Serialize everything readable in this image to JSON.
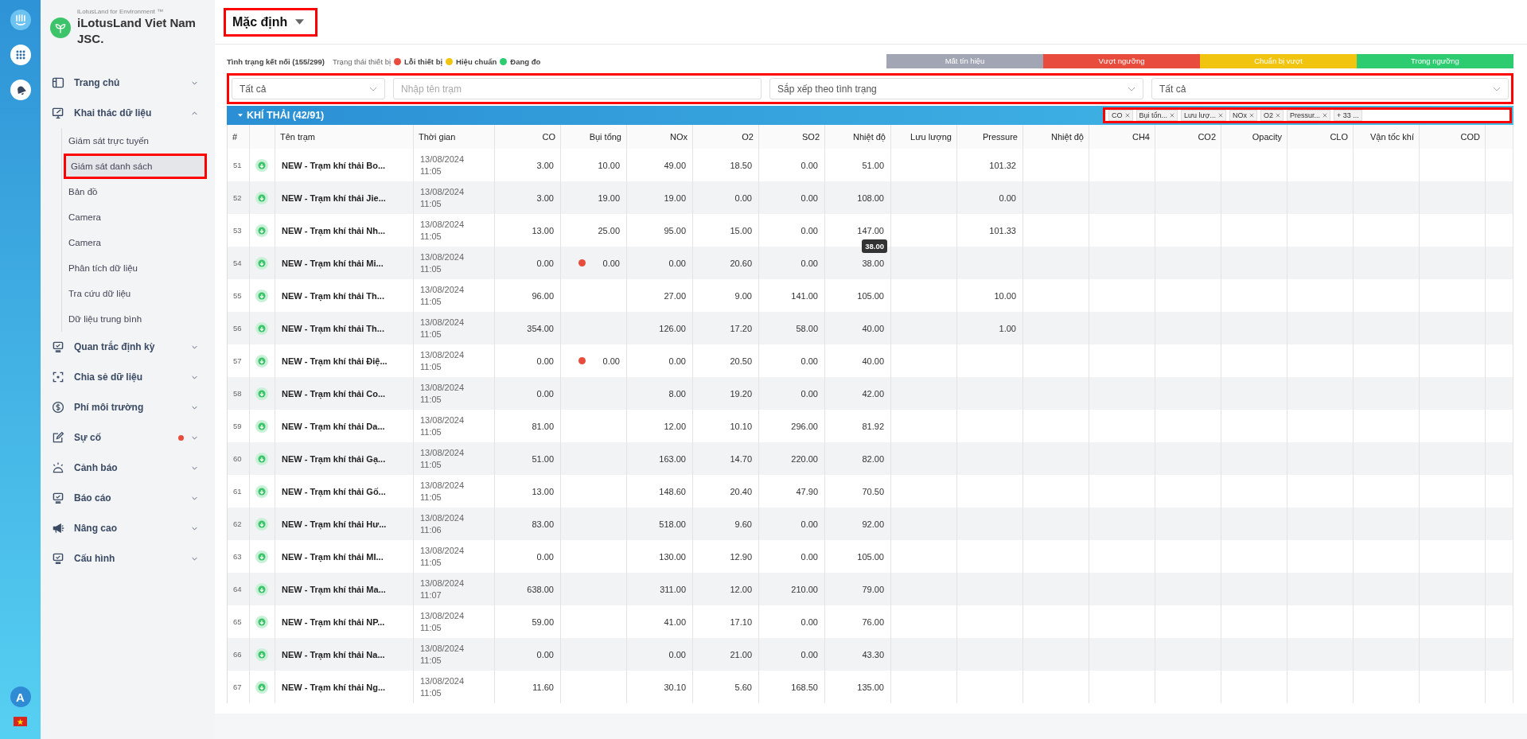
{
  "rail": {
    "user_initial": "A"
  },
  "brand": {
    "tagline": "iLotusLand for Environment ™",
    "name": "iLotusLand Viet Nam JSC."
  },
  "menu": [
    {
      "label": "Trang chủ",
      "expanded": false,
      "alert": false
    },
    {
      "label": "Khai thác dữ liệu",
      "expanded": true,
      "alert": false,
      "children": [
        {
          "label": "Giám sát trực tuyến",
          "selected": false,
          "highlighted": false
        },
        {
          "label": "Giám sát danh sách",
          "selected": true,
          "highlighted": true
        },
        {
          "label": "Bản đồ",
          "selected": false,
          "highlighted": false
        },
        {
          "label": "Camera",
          "selected": false,
          "highlighted": false
        },
        {
          "label": "Camera",
          "selected": false,
          "highlighted": false
        },
        {
          "label": "Phân tích dữ liệu",
          "selected": false,
          "highlighted": false
        },
        {
          "label": "Tra cứu dữ liệu",
          "selected": false,
          "highlighted": false
        },
        {
          "label": "Dữ liệu trung bình",
          "selected": false,
          "highlighted": false
        }
      ]
    },
    {
      "label": "Quan trắc định kỳ",
      "expanded": false,
      "alert": false
    },
    {
      "label": "Chia sẻ dữ liệu",
      "expanded": false,
      "alert": false
    },
    {
      "label": "Phí môi trường",
      "expanded": false,
      "alert": false
    },
    {
      "label": "Sự cố",
      "expanded": false,
      "alert": true
    },
    {
      "label": "Cảnh báo",
      "expanded": false,
      "alert": false
    },
    {
      "label": "Báo cáo",
      "expanded": false,
      "alert": false
    },
    {
      "label": "Nâng cao",
      "expanded": false,
      "alert": false
    },
    {
      "label": "Cấu hình",
      "expanded": false,
      "alert": false
    }
  ],
  "view_title": {
    "text": "Mặc định",
    "highlighted": true
  },
  "status": {
    "connection": "Tình trạng kết nối (155/299)",
    "device_label": "Trạng thái thiết bị",
    "device_states": [
      {
        "label": "Lỗi thiết bị",
        "color": "#e74c3c"
      },
      {
        "label": "Hiệu chuẩn",
        "color": "#f1c40f"
      },
      {
        "label": "Đang đo",
        "color": "#2ecc71"
      }
    ]
  },
  "legend": [
    {
      "label": "Mất tín hiệu",
      "color": "#a2a5b3"
    },
    {
      "label": "Vượt ngưỡng",
      "color": "#e74c3c"
    },
    {
      "label": "Chuẩn bị vượt",
      "color": "#f1c40f"
    },
    {
      "label": "Trong ngưỡng",
      "color": "#2ecc71"
    }
  ],
  "filters": {
    "highlighted": true,
    "fields": [
      {
        "kind": "select",
        "value": "Tất cả"
      },
      {
        "kind": "input",
        "placeholder": "Nhập tên trạm"
      },
      {
        "kind": "select",
        "value": "Sắp xếp theo tình trạng"
      },
      {
        "kind": "select",
        "value": "Tất cả"
      }
    ]
  },
  "section": {
    "title": "KHÍ THẢI (42/91)",
    "expanded": true,
    "tags_highlighted": true,
    "tags": [
      {
        "kind": "tag",
        "label": "CO"
      },
      {
        "kind": "tag",
        "label": "Bụi tổn..."
      },
      {
        "kind": "tag",
        "label": "Lưu lượ..."
      },
      {
        "kind": "tag",
        "label": "NOx"
      },
      {
        "kind": "tag",
        "label": "O2"
      },
      {
        "kind": "tag",
        "label": "Pressur..."
      },
      {
        "kind": "more",
        "label": "+ 33 ..."
      }
    ]
  },
  "table": {
    "columns": [
      "#",
      "Tên trạm",
      "Thời gian",
      "CO",
      "Bụi tổng",
      "NOx",
      "O2",
      "SO2",
      "Nhiệt độ",
      "Lưu lượng",
      "Pressure",
      "Nhiệt độ",
      "CH4",
      "CO2",
      "Opacity",
      "CLO",
      "Vận tốc khí",
      "COD"
    ],
    "rows": [
      {
        "no": "51",
        "name": "NEW - Trạm khí thải Bo...",
        "date": "13/08/2024",
        "time": "11:05",
        "alert": false,
        "co": "3.00",
        "dust": "10.00",
        "nox": "49.00",
        "o2": "18.50",
        "so2": "0.00",
        "temperature": "51.00",
        "pressure": "101.32"
      },
      {
        "no": "52",
        "name": "NEW - Trạm khí thải Jie...",
        "date": "13/08/2024",
        "time": "11:05",
        "alert": false,
        "co": "3.00",
        "dust": "19.00",
        "nox": "19.00",
        "o2": "0.00",
        "so2": "0.00",
        "temperature": "108.00",
        "pressure": "0.00"
      },
      {
        "no": "53",
        "name": "NEW - Trạm khí thải Nh...",
        "date": "13/08/2024",
        "time": "11:05",
        "alert": false,
        "co": "13.00",
        "dust": "25.00",
        "nox": "95.00",
        "o2": "15.00",
        "so2": "0.00",
        "temperature": "147.00",
        "pressure": "101.33"
      },
      {
        "no": "54",
        "name": "NEW - Trạm khí thải Mi...",
        "date": "13/08/2024",
        "time": "11:05",
        "alert": true,
        "co": "0.00",
        "dust": "0.00",
        "nox": "0.00",
        "o2": "20.60",
        "so2": "0.00",
        "temperature": "38.00",
        "tooltip": "38.00"
      },
      {
        "no": "55",
        "name": "NEW - Trạm khí thải Th...",
        "date": "13/08/2024",
        "time": "11:05",
        "alert": false,
        "co": "96.00",
        "nox": "27.00",
        "o2": "9.00",
        "so2": "141.00",
        "temperature": "105.00",
        "pressure": "10.00"
      },
      {
        "no": "56",
        "name": "NEW - Trạm khí thải Th...",
        "date": "13/08/2024",
        "time": "11:05",
        "alert": false,
        "co": "354.00",
        "nox": "126.00",
        "o2": "17.20",
        "so2": "58.00",
        "temperature": "40.00",
        "pressure": "1.00"
      },
      {
        "no": "57",
        "name": "NEW - Trạm khí thải Điệ...",
        "date": "13/08/2024",
        "time": "11:05",
        "alert": true,
        "co": "0.00",
        "dust": "0.00",
        "nox": "0.00",
        "o2": "20.50",
        "so2": "0.00",
        "temperature": "40.00"
      },
      {
        "no": "58",
        "name": "NEW - Trạm khí thải Co...",
        "date": "13/08/2024",
        "time": "11:05",
        "alert": false,
        "co": "0.00",
        "nox": "8.00",
        "o2": "19.20",
        "so2": "0.00",
        "temperature": "42.00"
      },
      {
        "no": "59",
        "name": "NEW - Trạm khí thải Da...",
        "date": "13/08/2024",
        "time": "11:05",
        "alert": false,
        "co": "81.00",
        "nox": "12.00",
        "o2": "10.10",
        "so2": "296.00",
        "temperature": "81.92"
      },
      {
        "no": "60",
        "name": "NEW - Trạm khí thải Gạ...",
        "date": "13/08/2024",
        "time": "11:05",
        "alert": false,
        "co": "51.00",
        "nox": "163.00",
        "o2": "14.70",
        "so2": "220.00",
        "temperature": "82.00"
      },
      {
        "no": "61",
        "name": "NEW - Trạm khí thải Gố...",
        "date": "13/08/2024",
        "time": "11:05",
        "alert": false,
        "co": "13.00",
        "nox": "148.60",
        "o2": "20.40",
        "so2": "47.90",
        "temperature": "70.50"
      },
      {
        "no": "62",
        "name": "NEW - Trạm khí thải Hư...",
        "date": "13/08/2024",
        "time": "11:06",
        "alert": false,
        "co": "83.00",
        "nox": "518.00",
        "o2": "9.60",
        "so2": "0.00",
        "temperature": "92.00"
      },
      {
        "no": "63",
        "name": "NEW - Trạm khí thải MI...",
        "date": "13/08/2024",
        "time": "11:05",
        "alert": false,
        "co": "0.00",
        "nox": "130.00",
        "o2": "12.90",
        "so2": "0.00",
        "temperature": "105.00"
      },
      {
        "no": "64",
        "name": "NEW - Trạm khí thải Ma...",
        "date": "13/08/2024",
        "time": "11:07",
        "alert": false,
        "co": "638.00",
        "nox": "311.00",
        "o2": "12.00",
        "so2": "210.00",
        "temperature": "79.00"
      },
      {
        "no": "65",
        "name": "NEW - Trạm khí thải NP...",
        "date": "13/08/2024",
        "time": "11:05",
        "alert": false,
        "co": "59.00",
        "nox": "41.00",
        "o2": "17.10",
        "so2": "0.00",
        "temperature": "76.00"
      },
      {
        "no": "66",
        "name": "NEW - Trạm khí thải Na...",
        "date": "13/08/2024",
        "time": "11:05",
        "alert": false,
        "co": "0.00",
        "nox": "0.00",
        "o2": "21.00",
        "so2": "0.00",
        "temperature": "43.30"
      },
      {
        "no": "67",
        "name": "NEW - Trạm khí thải Ng...",
        "date": "13/08/2024",
        "time": "11:05",
        "alert": false,
        "co": "11.60",
        "nox": "30.10",
        "o2": "5.60",
        "so2": "168.50",
        "temperature": "135.00"
      }
    ]
  }
}
